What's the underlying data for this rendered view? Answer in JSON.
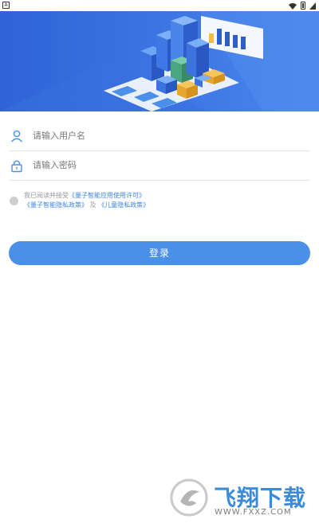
{
  "status_bar": {
    "left_icon": "notification-icon",
    "right_icons": [
      "wifi-icon",
      "battery-icon",
      "signal-icon"
    ]
  },
  "login_form": {
    "username_placeholder": "请输入用户名",
    "password_placeholder": "请输入密码",
    "username_icon": "user-icon",
    "password_icon": "lock-icon"
  },
  "agreement": {
    "prefix": "我已阅读并接受",
    "link_terms": "《量子智能应用使用许可》",
    "link_privacy": "《量子智能隐私政策》",
    "conjunction": "及",
    "link_child_privacy": "《儿童隐私政策》"
  },
  "login_button": {
    "label": "登录"
  },
  "watermark": {
    "title": "飞翔下载",
    "url": "WWW.FXXZ.COM"
  },
  "colors": {
    "accent": "#4a8fe8",
    "banner": "#3d6fe0",
    "link": "#3f86e3"
  }
}
